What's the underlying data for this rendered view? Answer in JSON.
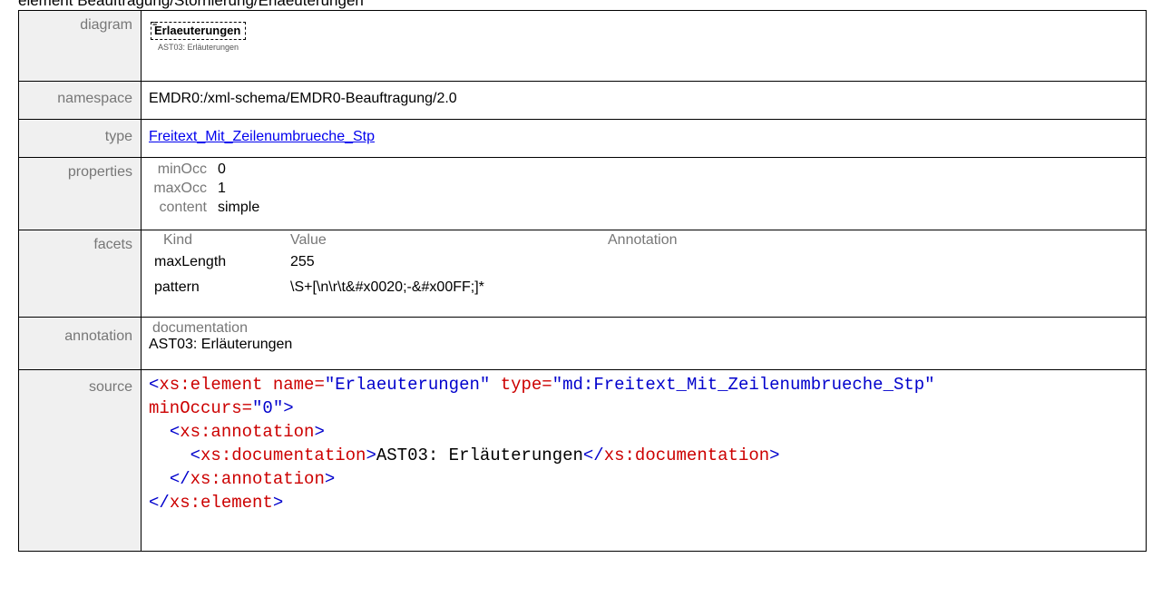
{
  "heading": "element Beauftragung/Stornierung/Erlaeuterungen",
  "rows": {
    "diagram": {
      "label": "diagram",
      "box_text": "Erlaeuterungen",
      "caption": "AST03: Erläuterungen"
    },
    "namespace": {
      "label": "namespace",
      "value": "EMDR0:/xml-schema/EMDR0-Beauftragung/2.0"
    },
    "type": {
      "label": "type",
      "value": "Freitext_Mit_Zeilenumbrueche_Stp"
    },
    "properties": {
      "label": "properties",
      "items": [
        {
          "key": "minOcc",
          "value": "0"
        },
        {
          "key": "maxOcc",
          "value": "1"
        },
        {
          "key": "content",
          "value": "simple"
        }
      ]
    },
    "facets": {
      "label": "facets",
      "headers": {
        "kind": "Kind",
        "value": "Value",
        "annotation": "Annotation"
      },
      "items": [
        {
          "kind": "maxLength",
          "value": "255"
        },
        {
          "kind": "pattern",
          "value": "\\S+[\\n\\r\\t&#x0020;-&#x00FF;]*"
        }
      ]
    },
    "annotation": {
      "label": "annotation",
      "header": "documentation",
      "value": "AST03: Erläuterungen"
    },
    "source": {
      "label": "source",
      "lines": [
        {
          "indent": "",
          "open": "<",
          "tag": "xs:element",
          "a1": " name=",
          "v1": "\"Erlaeuterungen\"",
          "a2": " type=",
          "v2": "\"md:Freitext_Mit_Zeilenumbrueche_Stp\"",
          "close": ""
        },
        {
          "indent": "",
          "open": "",
          "tag": "",
          "a1": "minOccurs=",
          "v1": "\"0\"",
          "a2": "",
          "v2": "",
          "close": ">"
        },
        {
          "indent": "  ",
          "open": "<",
          "tag": "xs:annotation",
          "a1": "",
          "v1": "",
          "a2": "",
          "v2": "",
          "close": ">"
        },
        {
          "indent": "    ",
          "open": "<",
          "tag": "xs:documentation",
          "a1": "",
          "v1": "",
          "a2": "",
          "v2": "",
          "close": ">"
        },
        {
          "indent": "  ",
          "open": "</",
          "tag": "xs:annotation",
          "a1": "",
          "v1": "",
          "a2": "",
          "v2": "",
          "close": ">"
        },
        {
          "indent": "",
          "open": "</",
          "tag": "xs:element",
          "a1": "",
          "v1": "",
          "a2": "",
          "v2": "",
          "close": ">"
        }
      ],
      "doc_text": "AST03: Erläuterungen",
      "doc_close_open": "</",
      "doc_close_tag": "xs:documentation",
      "doc_close_end": ">"
    }
  }
}
